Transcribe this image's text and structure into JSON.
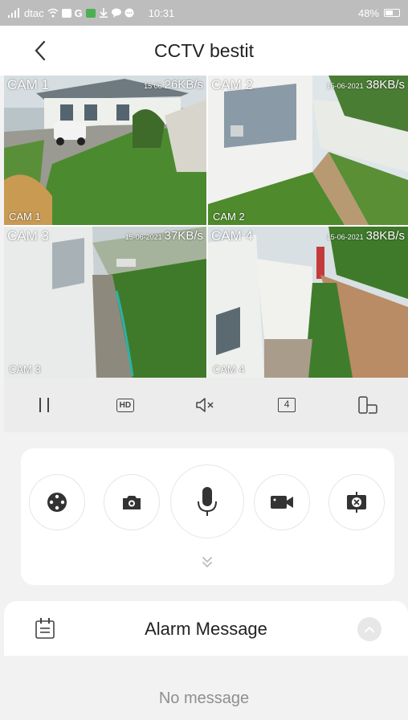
{
  "status_bar": {
    "carrier": "dtac",
    "g_label": "G",
    "time": "10:31",
    "battery_text": "48%",
    "battery_level": 0.48
  },
  "header": {
    "title": "CCTV bestit"
  },
  "cameras": [
    {
      "label": "CAM 1",
      "osd": "CAM 1",
      "date": "15 06",
      "rate": "26KB/s",
      "selected": true
    },
    {
      "label": "CAM 2",
      "osd": "CAM 2",
      "date": "15-06-2021",
      "rate": "38KB/s",
      "selected": false
    },
    {
      "label": "CAM 3",
      "osd": "CAM 3",
      "date": "15-06-2021",
      "rate": "37KB/s",
      "selected": false
    },
    {
      "label": "CAM 4",
      "osd": "CAM 4",
      "date": "15-06-2021",
      "rate": "38KB/s",
      "selected": false
    }
  ],
  "toolbar": {
    "pause_icon": "pause-icon",
    "hd_label": "HD",
    "mute_icon": "speaker-muted-icon",
    "split_label": "4",
    "rotate_icon": "screen-rotate-icon"
  },
  "controls": {
    "ptz_icon": "ptz-joystick-icon",
    "snapshot_icon": "camera-icon",
    "talk_icon": "microphone-icon",
    "record_icon": "video-record-icon",
    "close_all_icon": "close-all-icon",
    "expand_icon": "double-chevron-down-icon"
  },
  "alarm": {
    "title": "Alarm Message",
    "empty_text": "No message"
  },
  "colors": {
    "accent_selection": "#2d7ff0",
    "status_bar": "#bdbdbd",
    "app_background": "#f2f2f2"
  }
}
